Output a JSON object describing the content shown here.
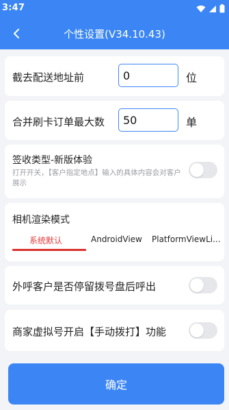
{
  "status_bar": {
    "time": "3:47"
  },
  "header": {
    "title": "个性设置(V34.10.43)"
  },
  "truncate_address": {
    "label": "截去配送地址前",
    "value": "0",
    "unit": "位"
  },
  "merge_orders": {
    "label": "合并刷卡订单最大数",
    "value": "50",
    "unit": "单"
  },
  "sign_type": {
    "label": "签收类型-新版体验",
    "description": "打开开关，【客户指定地点】输入的具体内容会对客户展示"
  },
  "camera_render": {
    "label": "相机渲染模式",
    "tabs": [
      "系统默认",
      "AndroidView",
      "PlatformViewLi..."
    ],
    "selected": "系统默认"
  },
  "call_stay": {
    "label": "外呼客户是否停留拨号盘后呼出"
  },
  "merchant_virtual": {
    "label": "商家虚拟号开启【手动拨打】功能"
  },
  "confirm": {
    "label": "确定"
  },
  "colors": {
    "primary": "#3b86f4",
    "active_tab": "#e33b3b",
    "toggle_off": "#e6e7ea"
  }
}
